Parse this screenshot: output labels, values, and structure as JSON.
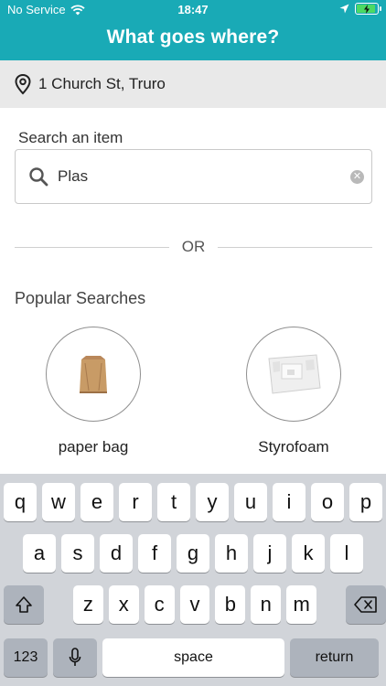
{
  "status_bar": {
    "carrier": "No Service",
    "time": "18:47"
  },
  "header": {
    "title": "What goes where?",
    "background_color": "#19aab6"
  },
  "location": {
    "address": "1 Church St, Truro",
    "icon": "location-pin-icon"
  },
  "search": {
    "label": "Search an item",
    "value": "Plas",
    "icon": "search-icon",
    "clear_icon": "clear-icon"
  },
  "divider": {
    "text": "OR"
  },
  "popular": {
    "title": "Popular Searches",
    "items": [
      {
        "label": "paper bag",
        "icon": "paper-bag-image"
      },
      {
        "label": "Styrofoam",
        "icon": "styrofoam-image"
      }
    ]
  },
  "keyboard": {
    "row1": [
      "q",
      "w",
      "e",
      "r",
      "t",
      "y",
      "u",
      "i",
      "o",
      "p"
    ],
    "row2": [
      "a",
      "s",
      "d",
      "f",
      "g",
      "h",
      "j",
      "k",
      "l"
    ],
    "row3": [
      "z",
      "x",
      "c",
      "v",
      "b",
      "n",
      "m"
    ],
    "numbers_label": "123",
    "space_label": "space",
    "return_label": "return"
  }
}
